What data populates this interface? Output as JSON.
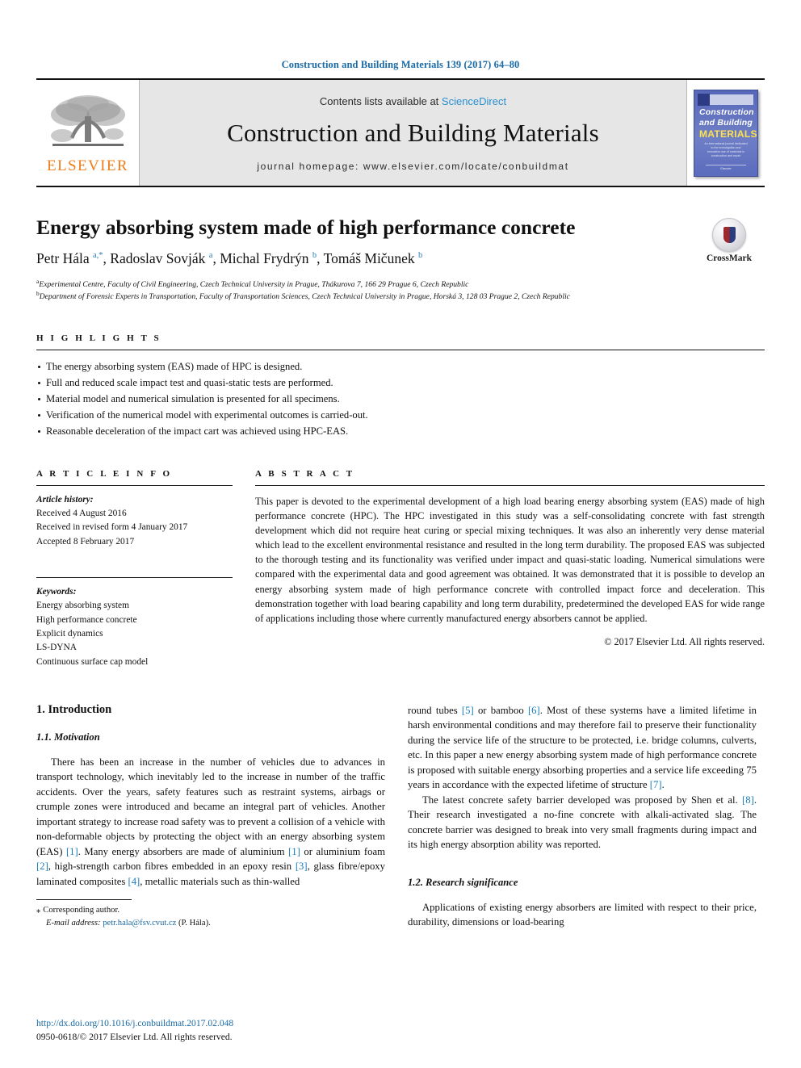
{
  "running_head": "Construction and Building Materials 139 (2017) 64–80",
  "masthead": {
    "elsevier_wordmark": "ELSEVIER",
    "contents_prefix": "Contents lists available at ",
    "contents_link": "ScienceDirect",
    "journal_title": "Construction and Building Materials",
    "journal_homepage": "journal homepage: www.elsevier.com/locate/conbuildmat",
    "cover": {
      "line1": "Construction",
      "line2": "and Building",
      "line3": "MATERIALS",
      "subtitle": "An international journal dedicated to the investigation and innovative use of materials in construction and repair",
      "footer": "Elsevier"
    }
  },
  "article": {
    "title": "Energy absorbing system made of high performance concrete",
    "authors_html": "Petr Hála <sup>a,*</sup>, Radoslav Sovják <sup>a</sup>, Michal Frydrýn <sup>b</sup>, Tomáš Mičunek <sup>b</sup>",
    "affiliation_a": "Experimental Centre, Faculty of Civil Engineering, Czech Technical University in Prague, Thákurova 7, 166 29 Prague 6, Czech Republic",
    "affiliation_b": "Department of Forensic Experts in Transportation, Faculty of Transportation Sciences, Czech Technical University in Prague, Horská 3, 128 03 Prague 2, Czech Republic",
    "crossmark_label": "CrossMark"
  },
  "highlights": {
    "heading": "H I G H L I G H T S",
    "items": [
      "The energy absorbing system (EAS) made of HPC is designed.",
      "Full and reduced scale impact test and quasi-static tests are performed.",
      "Material model and numerical simulation is presented for all specimens.",
      "Verification of the numerical model with experimental outcomes is carried-out.",
      "Reasonable deceleration of the impact cart was achieved using HPC-EAS."
    ]
  },
  "article_info": {
    "heading": "A R T I C L E   I N F O",
    "history_label": "Article history:",
    "history": [
      "Received 4 August 2016",
      "Received in revised form 4 January 2017",
      "Accepted 8 February 2017"
    ],
    "keywords_label": "Keywords:",
    "keywords": [
      "Energy absorbing system",
      "High performance concrete",
      "Explicit dynamics",
      "LS-DYNA",
      "Continuous surface cap model"
    ]
  },
  "abstract": {
    "heading": "A B S T R A C T",
    "text": "This paper is devoted to the experimental development of a high load bearing energy absorbing system (EAS) made of high performance concrete (HPC). The HPC investigated in this study was a self-consolidating concrete with fast strength development which did not require heat curing or special mixing techniques. It was also an inherently very dense material which lead to the excellent environmental resistance and resulted in the long term durability. The proposed EAS was subjected to the thorough testing and its functionality was verified under impact and quasi-static loading. Numerical simulations were compared with the experimental data and good agreement was obtained. It was demonstrated that it is possible to develop an energy absorbing system made of high performance concrete with controlled impact force and deceleration. This demonstration together with load bearing capability and long term durability, predetermined the developed EAS for wide range of applications including those where currently manufactured energy absorbers cannot be applied.",
    "copyright": "© 2017 Elsevier Ltd. All rights reserved."
  },
  "body": {
    "section1_heading": "1. Introduction",
    "section11_heading": "1.1. Motivation",
    "section12_heading": "1.2. Research significance",
    "left_para1_a": "There has been an increase in the number of vehicles due to advances in transport technology, which inevitably led to the increase in number of the traffic accidents. Over the years, safety features such as restraint systems, airbags or crumple zones were introduced and became an integral part of vehicles. Another important strategy to increase road safety was to prevent a collision of a vehicle with non-deformable objects by protecting the object with an energy absorbing system (EAS) ",
    "left_para1_r1": "[1]",
    "left_para1_b": ". Many energy absorbers are made of aluminium ",
    "left_para1_r2": "[1]",
    "left_para1_c": " or aluminium foam ",
    "left_para1_r3": "[2]",
    "left_para1_d": ", high-strength carbon fibres embedded in an epoxy resin ",
    "left_para1_r4": "[3]",
    "left_para1_e": ", glass fibre/epoxy laminated composites ",
    "left_para1_r5": "[4]",
    "left_para1_f": ", metallic materials such as thin-walled",
    "right_para1_a": "round tubes ",
    "right_para1_r1": "[5]",
    "right_para1_b": " or bamboo ",
    "right_para1_r2": "[6]",
    "right_para1_c": ". Most of these systems have a limited lifetime in harsh environmental conditions and may therefore fail to preserve their functionality during the service life of the structure to be protected, i.e. bridge columns, culverts, etc. In this paper a new energy absorbing system made of high performance concrete is proposed with suitable energy absorbing properties and a service life exceeding 75 years in accordance with the expected lifetime of structure ",
    "right_para1_r3": "[7]",
    "right_para1_d": ".",
    "right_para2_a": "The latest concrete safety barrier developed was proposed by Shen et al. ",
    "right_para2_r1": "[8]",
    "right_para2_b": ". Their research investigated a no-fine concrete with alkali-activated slag. The concrete barrier was designed to break into very small fragments during impact and its high energy absorption ability was reported.",
    "right_para3": "Applications of existing energy absorbers are limited with respect to their price, durability, dimensions or load-bearing"
  },
  "footnote": {
    "corresponding": "Corresponding author.",
    "email_label": "E-mail address:",
    "email": "petr.hala@fsv.cvut.cz",
    "email_suffix": " (P. Hála)."
  },
  "bottom": {
    "doi": "http://dx.doi.org/10.1016/j.conbuildmat.2017.02.048",
    "issn": "0950-0618/© 2017 Elsevier Ltd. All rights reserved."
  },
  "colors": {
    "link_blue": "#1a6aa5",
    "ref_blue": "#1a7cb8",
    "sciencedirect_blue": "#2a8fd0",
    "elsevier_orange": "#f07d19"
  }
}
